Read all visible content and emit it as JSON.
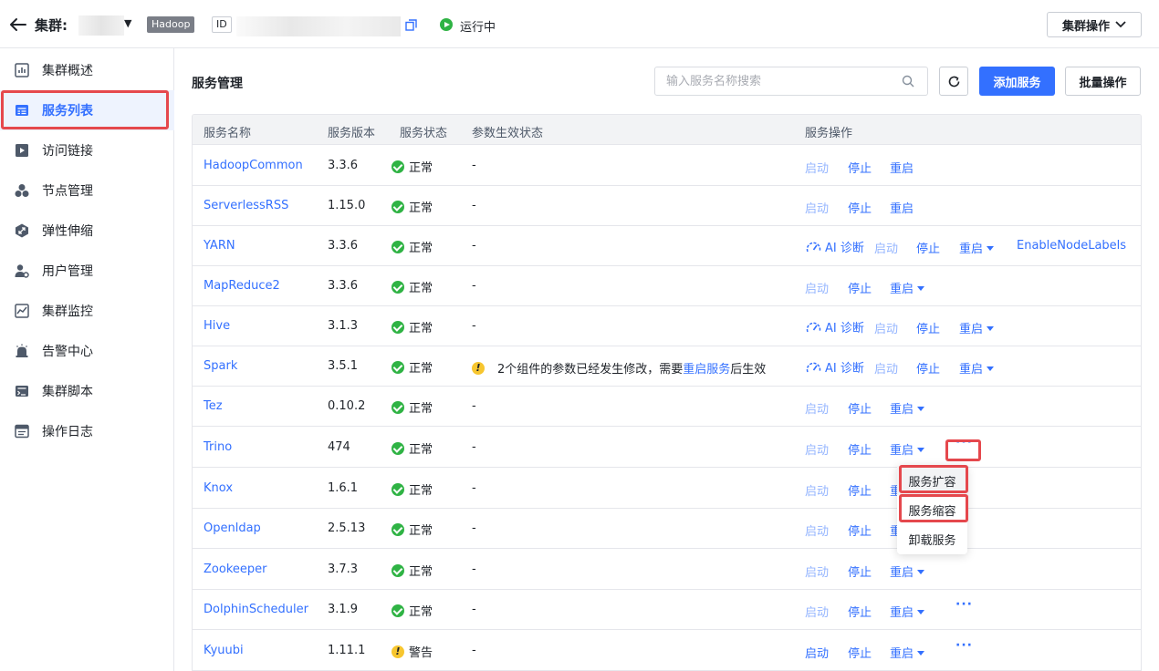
{
  "header": {
    "cluster_label": "集群:",
    "hadoop_tag": "Hadoop",
    "id_label": "ID",
    "status": "运行中",
    "cluster_ops": "集群操作"
  },
  "sidebar": {
    "items": [
      {
        "label": "集群概述",
        "icon": "bar-chart-icon"
      },
      {
        "label": "服务列表",
        "icon": "list-icon",
        "active": true
      },
      {
        "label": "访问链接",
        "icon": "play-link-icon"
      },
      {
        "label": "节点管理",
        "icon": "nodes-icon"
      },
      {
        "label": "弹性伸缩",
        "icon": "scaling-icon"
      },
      {
        "label": "用户管理",
        "icon": "user-gear-icon"
      },
      {
        "label": "集群监控",
        "icon": "monitor-icon"
      },
      {
        "label": "告警中心",
        "icon": "alarm-icon"
      },
      {
        "label": "集群脚本",
        "icon": "script-icon"
      },
      {
        "label": "操作日志",
        "icon": "log-icon"
      }
    ]
  },
  "main": {
    "title": "服务管理",
    "search_placeholder": "输入服务名称搜索",
    "add_button": "添加服务",
    "batch_button": "批量操作"
  },
  "table": {
    "headers": [
      "服务名称",
      "服务版本",
      "服务状态",
      "参数生效状态",
      "服务操作"
    ],
    "actions": {
      "start": "启动",
      "stop": "停止",
      "restart": "重启",
      "ai": "AI 诊断",
      "more": "···"
    },
    "rows": [
      {
        "name": "HadoopCommon",
        "version": "3.3.6",
        "status": "正常",
        "param": "-"
      },
      {
        "name": "ServerlessRSS",
        "version": "1.15.0",
        "status": "正常",
        "param": "-"
      },
      {
        "name": "YARN",
        "version": "3.3.6",
        "status": "正常",
        "param": "-",
        "extra": "EnableNodeLabels"
      },
      {
        "name": "MapReduce2",
        "version": "3.3.6",
        "status": "正常",
        "param": "-"
      },
      {
        "name": "Hive",
        "version": "3.1.3",
        "status": "正常",
        "param": "-"
      },
      {
        "name": "Spark",
        "version": "3.5.1",
        "status": "正常",
        "param_pre": "2个组件的参数已经发生修改，需要",
        "param_link": "重启服务",
        "param_post": "后生效"
      },
      {
        "name": "Tez",
        "version": "0.10.2",
        "status": "正常",
        "param": "-"
      },
      {
        "name": "Trino",
        "version": "474",
        "status": "正常",
        "param": "-"
      },
      {
        "name": "Knox",
        "version": "1.6.1",
        "status": "正常",
        "param": "-"
      },
      {
        "name": "Openldap",
        "version": "2.5.13",
        "status": "正常",
        "param": "-"
      },
      {
        "name": "Zookeeper",
        "version": "3.7.3",
        "status": "正常",
        "param": "-"
      },
      {
        "name": "DolphinScheduler",
        "version": "3.1.9",
        "status": "正常",
        "param": "-"
      },
      {
        "name": "Kyuubi",
        "version": "1.11.1",
        "status": "警告",
        "param": "-"
      }
    ]
  },
  "menu": {
    "items": [
      "服务扩容",
      "服务缩容",
      "卸载服务"
    ]
  }
}
